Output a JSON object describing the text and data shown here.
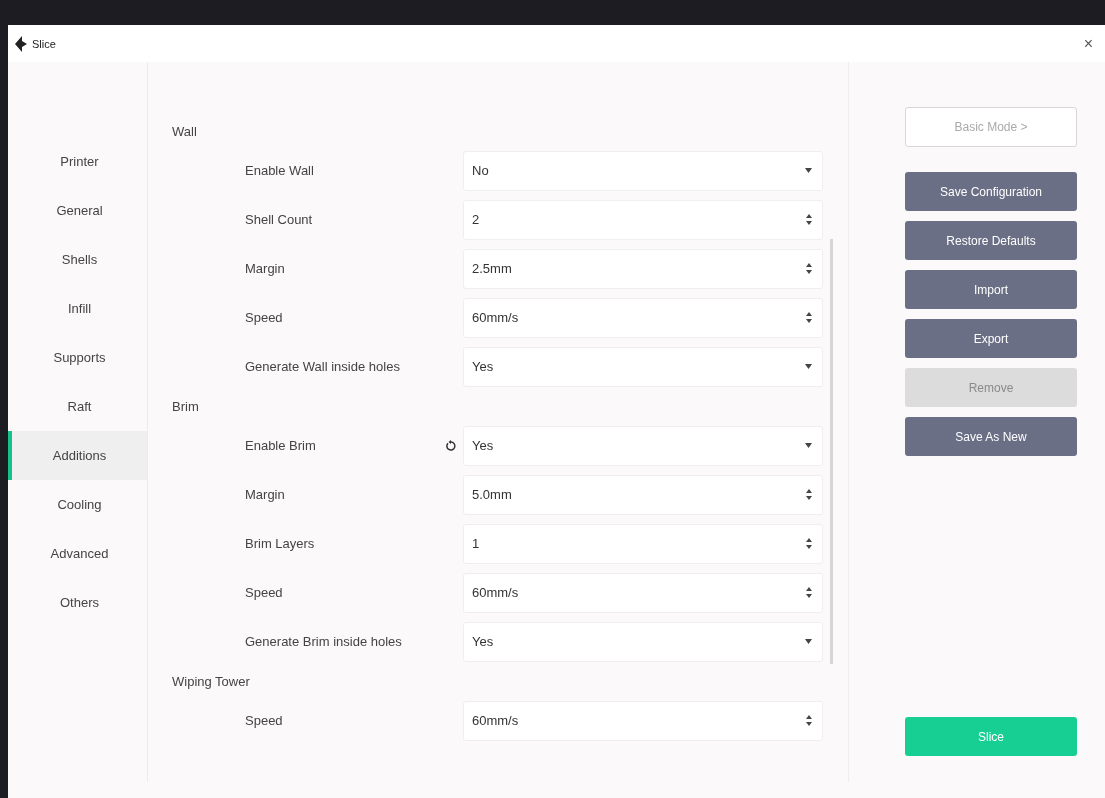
{
  "window": {
    "title": "Slice",
    "close": "×"
  },
  "sidebar": {
    "items": [
      {
        "label": "Printer",
        "selected": false
      },
      {
        "label": "General",
        "selected": false
      },
      {
        "label": "Shells",
        "selected": false
      },
      {
        "label": "Infill",
        "selected": false
      },
      {
        "label": "Supports",
        "selected": false
      },
      {
        "label": "Raft",
        "selected": false
      },
      {
        "label": "Additions",
        "selected": true
      },
      {
        "label": "Cooling",
        "selected": false
      },
      {
        "label": "Advanced",
        "selected": false
      },
      {
        "label": "Others",
        "selected": false
      }
    ]
  },
  "sections": [
    {
      "title": "Wall",
      "rows": [
        {
          "label": "Enable Wall",
          "value": "No",
          "kind": "select",
          "reset": false
        },
        {
          "label": "Shell Count",
          "value": "2",
          "kind": "spin",
          "reset": false
        },
        {
          "label": "Margin",
          "value": "2.5mm",
          "kind": "spin",
          "reset": false
        },
        {
          "label": "Speed",
          "value": "60mm/s",
          "kind": "spin",
          "reset": false
        },
        {
          "label": "Generate Wall inside holes",
          "value": "Yes",
          "kind": "select",
          "reset": false
        }
      ]
    },
    {
      "title": "Brim",
      "rows": [
        {
          "label": "Enable Brim",
          "value": "Yes",
          "kind": "select",
          "reset": true
        },
        {
          "label": "Margin",
          "value": "5.0mm",
          "kind": "spin",
          "reset": false
        },
        {
          "label": "Brim Layers",
          "value": "1",
          "kind": "spin",
          "reset": false
        },
        {
          "label": "Speed",
          "value": "60mm/s",
          "kind": "spin",
          "reset": false
        },
        {
          "label": "Generate Brim inside holes",
          "value": "Yes",
          "kind": "select",
          "reset": false
        }
      ]
    },
    {
      "title": "Wiping Tower",
      "rows": [
        {
          "label": "Speed",
          "value": "60mm/s",
          "kind": "spin",
          "reset": false
        }
      ]
    }
  ],
  "mode_button": {
    "label": "Basic Mode >"
  },
  "actions": [
    {
      "label": "Save Configuration",
      "disabled": false
    },
    {
      "label": "Restore Defaults",
      "disabled": false
    },
    {
      "label": "Import",
      "disabled": false
    },
    {
      "label": "Export",
      "disabled": false
    },
    {
      "label": "Remove",
      "disabled": true
    },
    {
      "label": "Save As New",
      "disabled": false
    }
  ],
  "slice_button": {
    "label": "Slice"
  }
}
